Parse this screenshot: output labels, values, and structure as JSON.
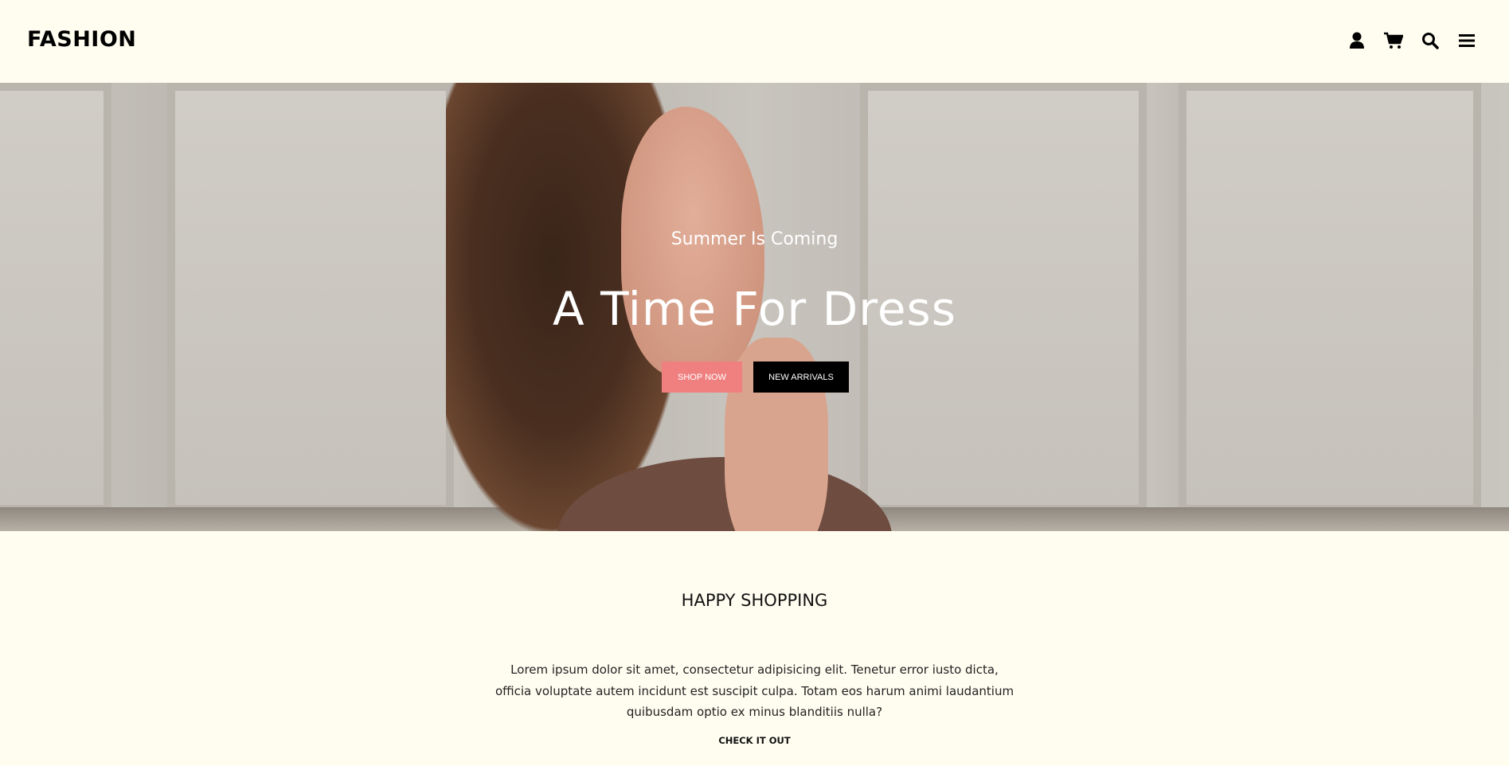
{
  "header": {
    "logo": "FASHION",
    "icons": [
      "user-icon",
      "cart-icon",
      "search-icon",
      "menu-icon"
    ]
  },
  "hero": {
    "subtitle": "Summer Is Coming",
    "title": "A Time For Dress",
    "shop_now": "SHOP NOW",
    "new_arrivals": "NEW ARRIVALS",
    "accent": "#f08080"
  },
  "about": {
    "heading": "HAPPY SHOPPING",
    "text": "Lorem ipsum dolor sit amet, consectetur adipisicing elit. Tenetur error iusto dicta, officia voluptate autem incidunt est suscipit culpa. Totam eos harum animi laudantium quibusdam optio ex minus blanditiis nulla?",
    "link": "CHECK IT OUT"
  }
}
